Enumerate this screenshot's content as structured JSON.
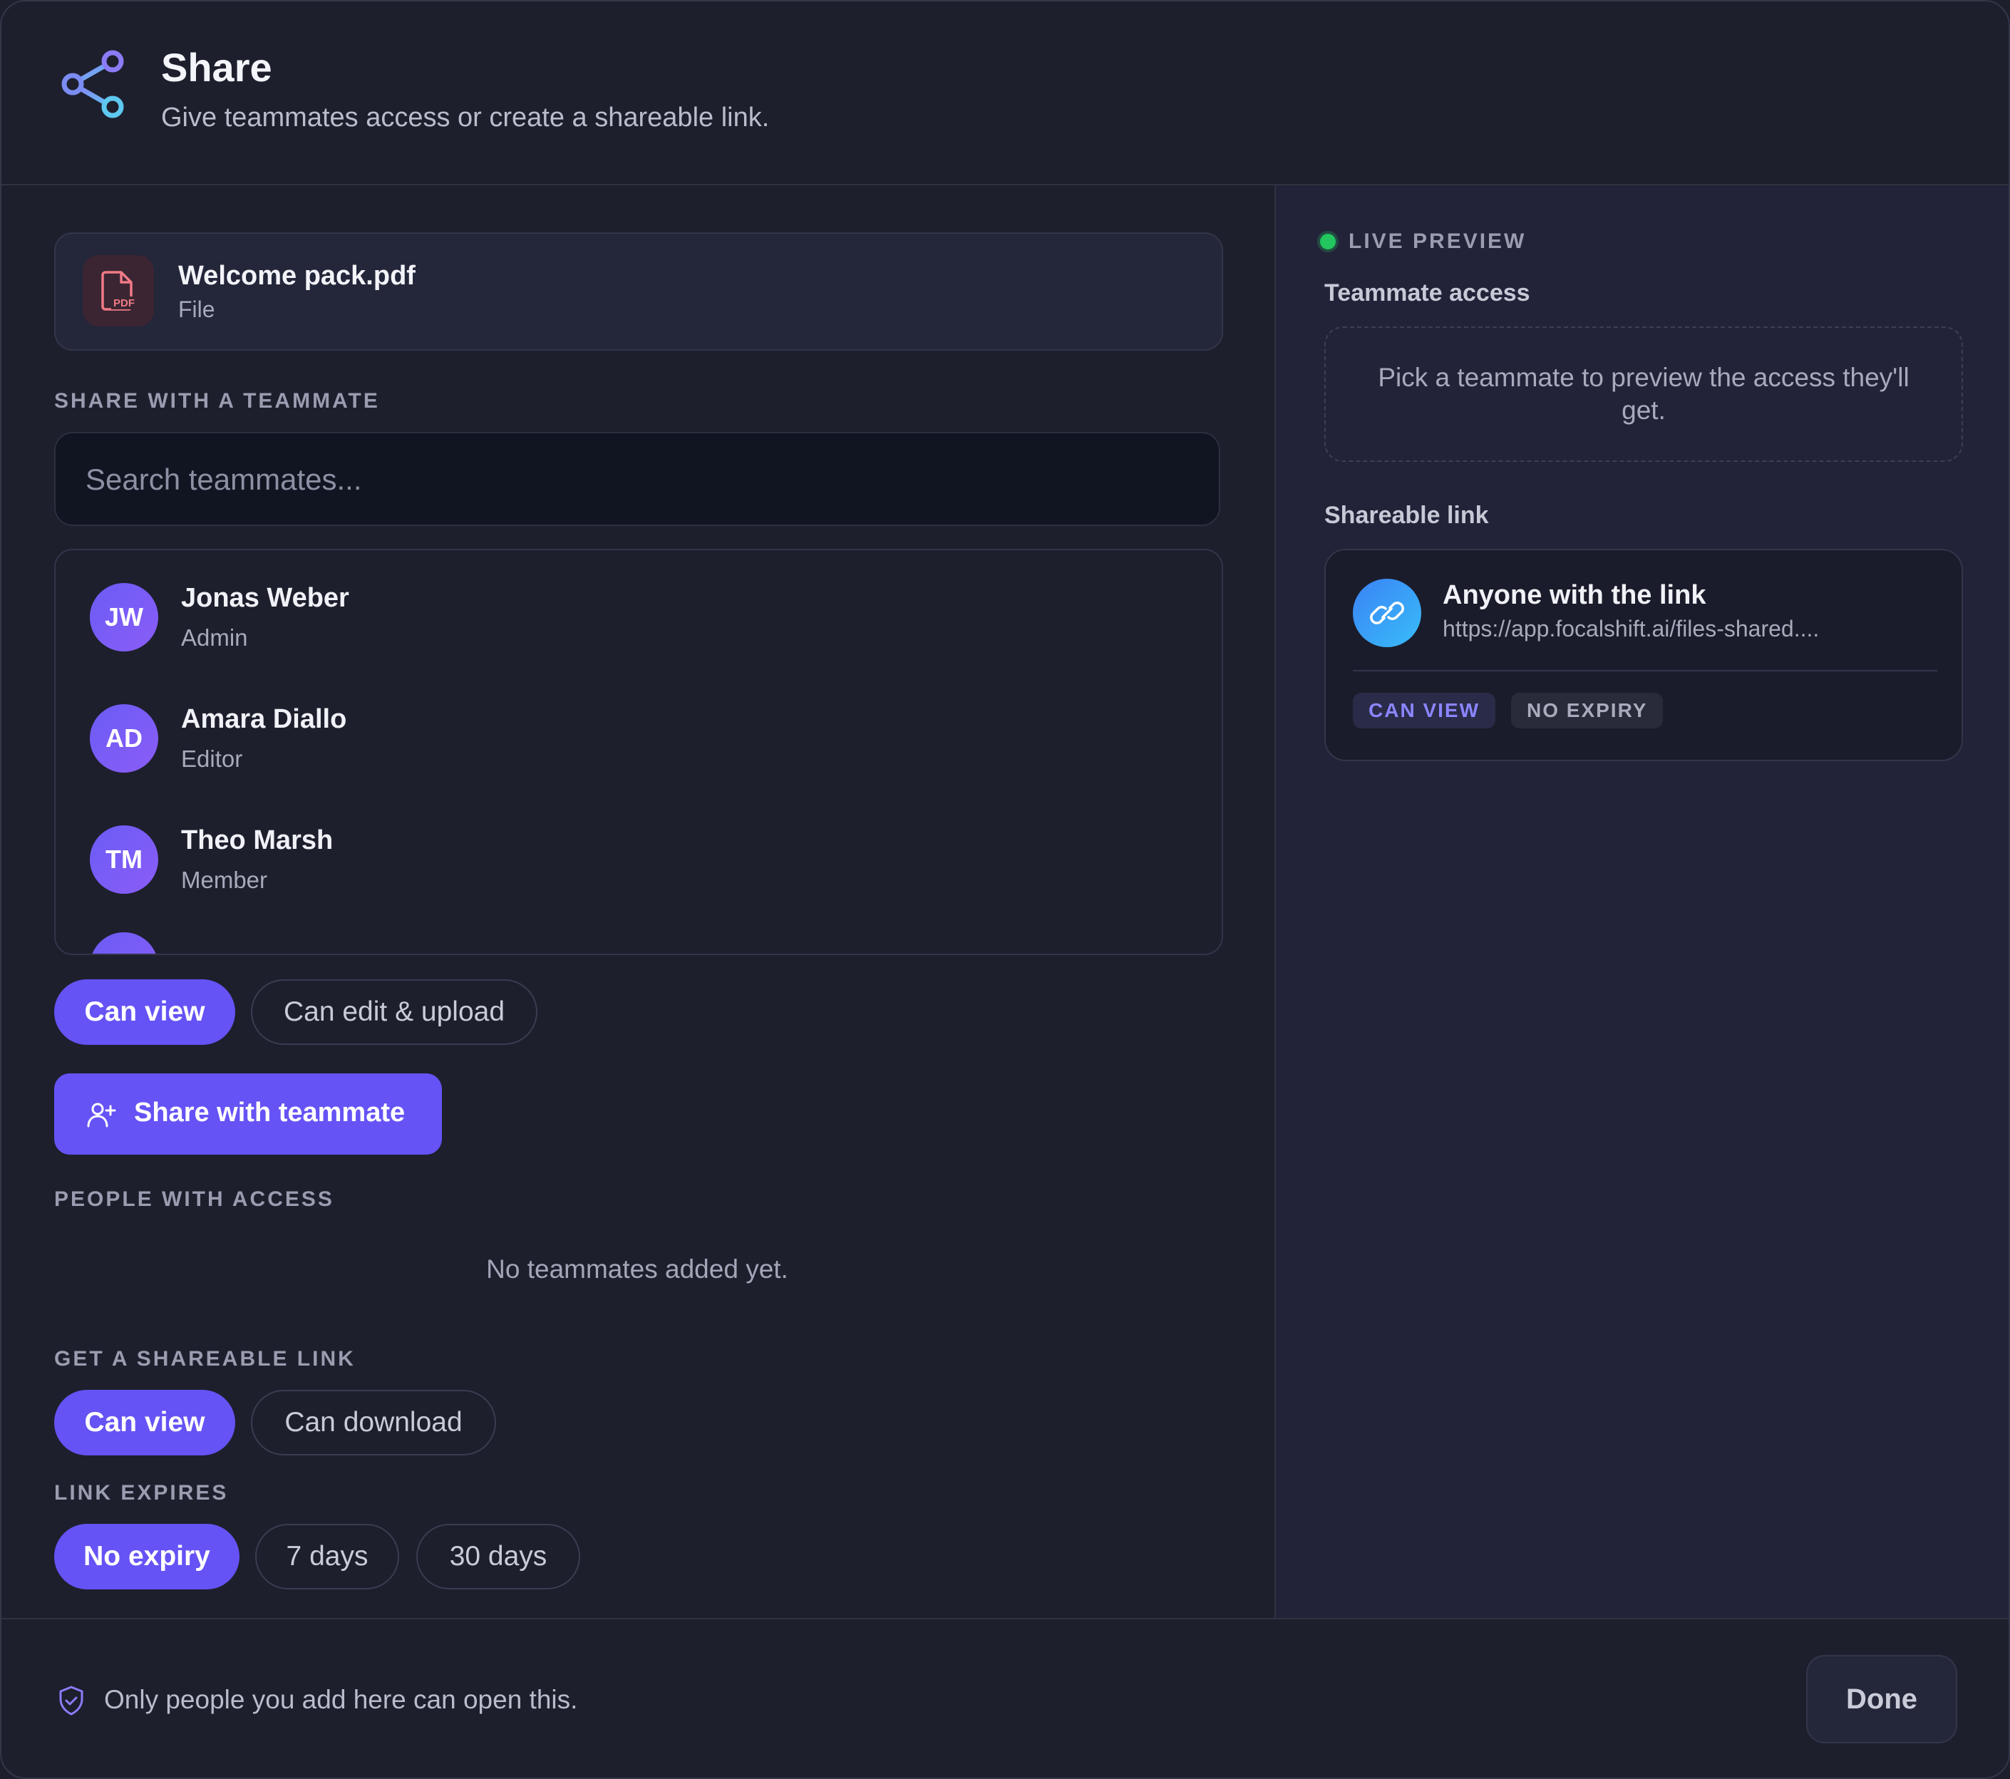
{
  "header": {
    "title": "Share",
    "subtitle": "Give teammates access or create a shareable link.",
    "icon": "share-icon"
  },
  "file": {
    "name": "Welcome pack.pdf",
    "type": "File",
    "icon_text": "PDF",
    "icon": "pdf-file-icon"
  },
  "teammate_section": {
    "label": "SHARE WITH A TEAMMATE",
    "search_placeholder": "Search teammates...",
    "people": [
      {
        "initials": "JW",
        "name": "Jonas Weber",
        "role": "Admin"
      },
      {
        "initials": "AD",
        "name": "Amara Diallo",
        "role": "Editor"
      },
      {
        "initials": "TM",
        "name": "Theo Marsh",
        "role": "Member"
      }
    ],
    "permissions": [
      "Can view",
      "Can edit & upload"
    ],
    "selected_permission": "Can view",
    "share_button": "Share with teammate"
  },
  "access_section": {
    "label": "PEOPLE WITH ACCESS",
    "empty": "No teammates added yet."
  },
  "link_section": {
    "label": "GET A SHAREABLE LINK",
    "permissions": [
      "Can view",
      "Can download"
    ],
    "selected_permission": "Can view",
    "expires_label": "LINK EXPIRES",
    "expiry_options": [
      "No expiry",
      "7 days",
      "30 days"
    ],
    "selected_expiry": "No expiry"
  },
  "preview": {
    "live_label": "LIVE PREVIEW",
    "teammate_title": "Teammate access",
    "teammate_placeholder": "Pick a teammate to preview the access they'll get.",
    "link_title": "Shareable link",
    "link_card_title": "Anyone with the link",
    "link_url": "https://app.focalshift.ai/files-shared....",
    "badges": [
      "CAN VIEW",
      "NO EXPIRY"
    ]
  },
  "footer": {
    "note": "Only people you add here can open this.",
    "done": "Done"
  },
  "colors": {
    "accent": "#6553f5",
    "background": "#1d1f2d",
    "panel": "#222339",
    "live": "#22c55e"
  }
}
